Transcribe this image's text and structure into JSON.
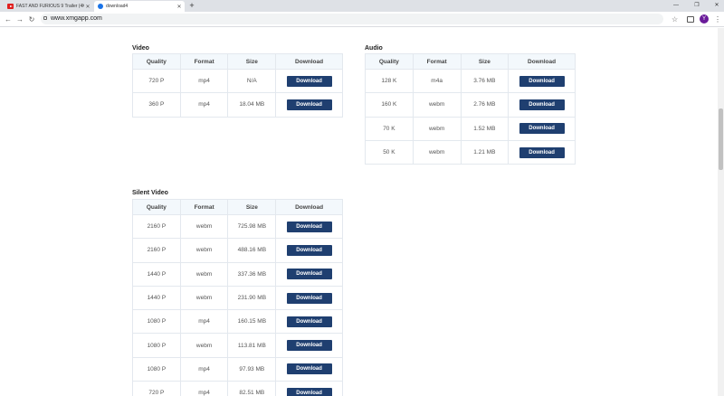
{
  "browser": {
    "tabs": [
      {
        "title": "FAST AND FURIOUS 9 Trailer (4K"
      },
      {
        "title": "download4"
      }
    ],
    "address": "www.xmgapp.com",
    "avatar_letter": "Y"
  },
  "video": {
    "title": "Video",
    "headers": [
      "Quality",
      "Format",
      "Size",
      "Download"
    ],
    "rows": [
      {
        "quality": "720 P",
        "format": "mp4",
        "size": "N/A",
        "button": "Download"
      },
      {
        "quality": "360 P",
        "format": "mp4",
        "size": "18.04 MB",
        "button": "Download"
      }
    ]
  },
  "audio": {
    "title": "Audio",
    "headers": [
      "Quality",
      "Format",
      "Size",
      "Download"
    ],
    "rows": [
      {
        "quality": "128 K",
        "format": "m4a",
        "size": "3.76 MB",
        "button": "Download"
      },
      {
        "quality": "160 K",
        "format": "webm",
        "size": "2.76 MB",
        "button": "Download"
      },
      {
        "quality": "70 K",
        "format": "webm",
        "size": "1.52 MB",
        "button": "Download"
      },
      {
        "quality": "50 K",
        "format": "webm",
        "size": "1.21 MB",
        "button": "Download"
      }
    ]
  },
  "silent_video": {
    "title": "Silent Video",
    "headers": [
      "Quality",
      "Format",
      "Size",
      "Download"
    ],
    "rows": [
      {
        "quality": "2160 P",
        "format": "webm",
        "size": "725.98 MB",
        "button": "Download"
      },
      {
        "quality": "2160 P",
        "format": "webm",
        "size": "488.16 MB",
        "button": "Download"
      },
      {
        "quality": "1440 P",
        "format": "webm",
        "size": "337.36 MB",
        "button": "Download"
      },
      {
        "quality": "1440 P",
        "format": "webm",
        "size": "231.90 MB",
        "button": "Download"
      },
      {
        "quality": "1080 P",
        "format": "mp4",
        "size": "160.15 MB",
        "button": "Download"
      },
      {
        "quality": "1080 P",
        "format": "webm",
        "size": "113.81 MB",
        "button": "Download"
      },
      {
        "quality": "1080 P",
        "format": "mp4",
        "size": "97.93 MB",
        "button": "Download"
      },
      {
        "quality": "720 P",
        "format": "mp4",
        "size": "82.51 MB",
        "button": "Download"
      }
    ]
  }
}
